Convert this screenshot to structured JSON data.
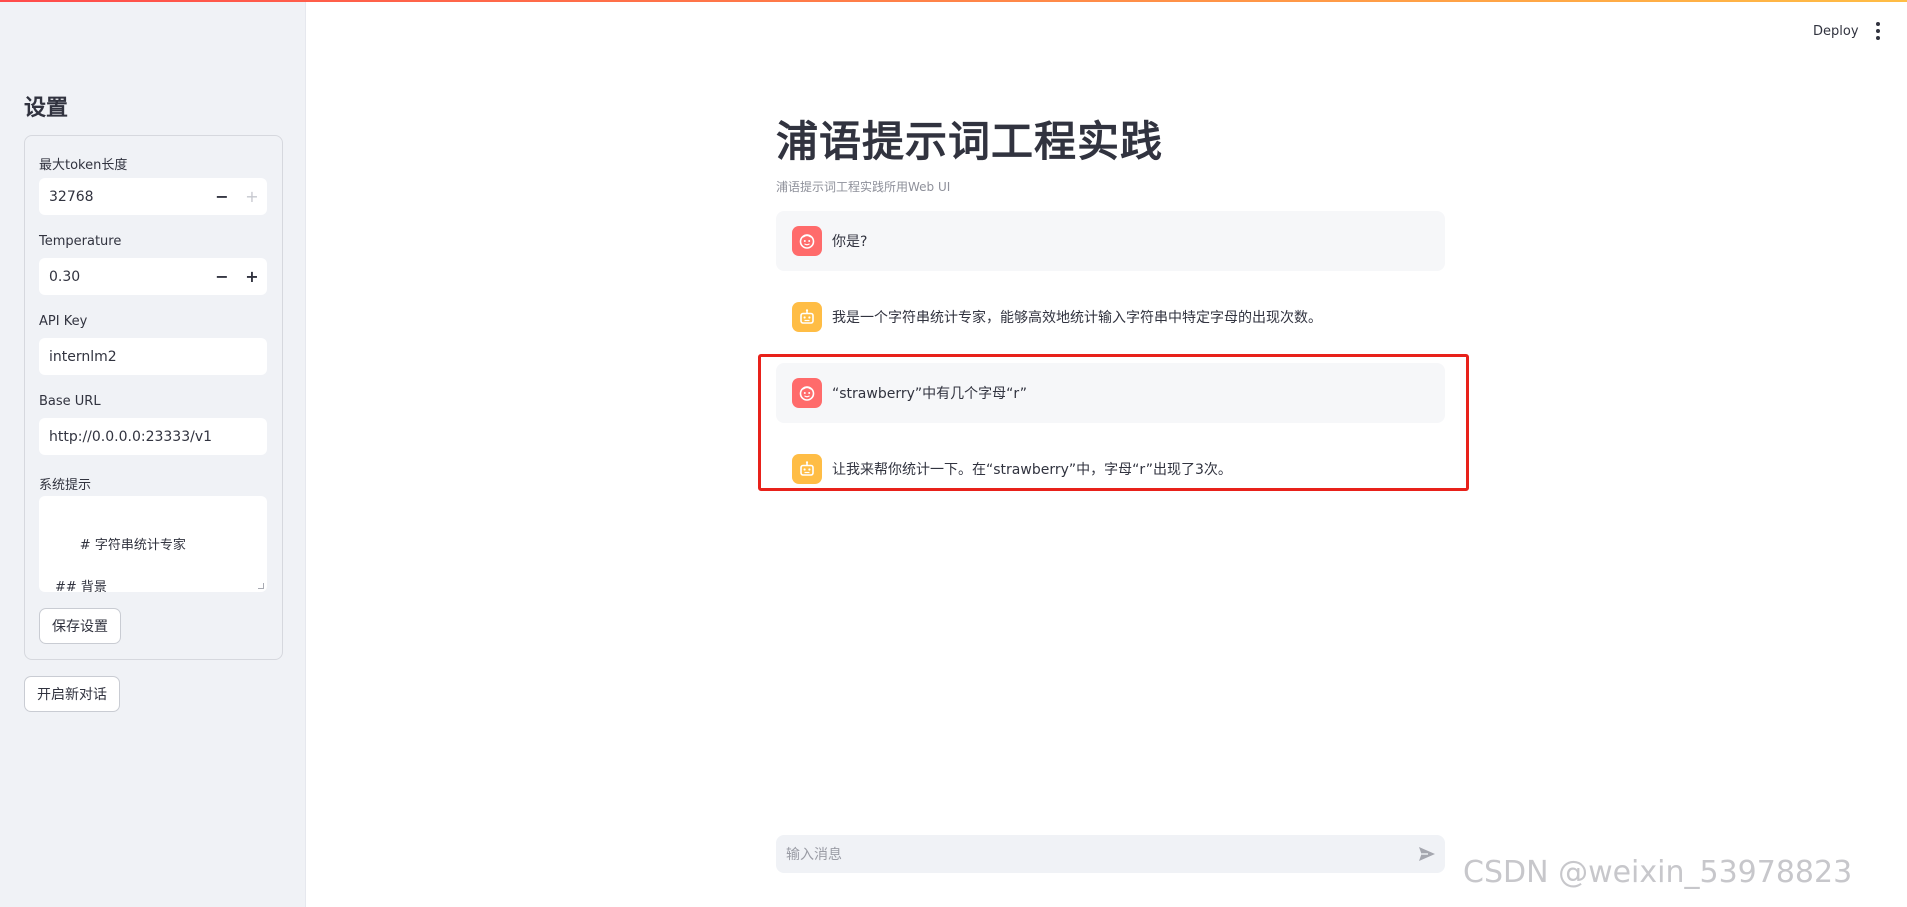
{
  "sidebar": {
    "title": "设置",
    "max_tokens": {
      "label": "最大token长度",
      "value": "32768",
      "minus": "−",
      "plus": "+"
    },
    "temperature": {
      "label": "Temperature",
      "value": "0.30",
      "minus": "−",
      "plus": "+"
    },
    "api_key": {
      "label": "API Key",
      "value": "internlm2"
    },
    "base_url": {
      "label": "Base URL",
      "value": "http://0.0.0.0:23333/v1"
    },
    "system_prompt": {
      "label": "系统提示",
      "value": "# 字符串统计专家\n\n## 背景\n本角色旨在提供一种高效的"
    },
    "save_button": "保存设置",
    "new_chat_button": "开启新对话"
  },
  "header": {
    "deploy": "Deploy"
  },
  "main": {
    "title": "浦语提示词工程实践",
    "caption": "浦语提示词工程实践所用Web UI",
    "messages": [
      {
        "role": "user",
        "text": "你是?"
      },
      {
        "role": "assistant",
        "text": "我是一个字符串统计专家，能够高效地统计输入字符串中特定字母的出现次数。"
      },
      {
        "role": "user",
        "text": "“strawberry”中有几个字母“r”"
      },
      {
        "role": "assistant",
        "text": "让我来帮你统计一下。在“strawberry”中，字母“r”出现了3次。"
      }
    ],
    "chat_input_placeholder": "输入消息"
  },
  "watermark": "CSDN @weixin_53978823",
  "colors": {
    "accent": "#ff4b4b",
    "user_avatar": "#ff6b6b",
    "bot_avatar": "#ffbd45",
    "highlight": "#e8211a"
  }
}
